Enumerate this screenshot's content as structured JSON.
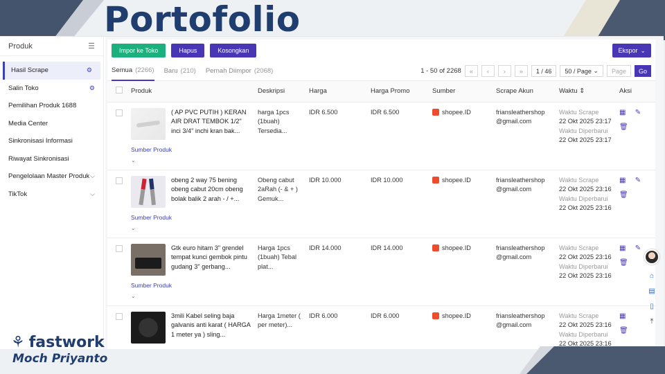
{
  "slide": {
    "title": "Portofolio",
    "brand": "fastwork",
    "author": "Moch Priyanto"
  },
  "colors": {
    "primary": "#4936b5",
    "green": "#1bb07d",
    "brand_navy": "#1f3d6e",
    "shopee": "#ee4d2d"
  },
  "sidebar": {
    "header": "Produk",
    "collapse_icon": "collapse-icon",
    "items": [
      {
        "label": "Hasil Scrape",
        "active": true,
        "icon": "gear-icon"
      },
      {
        "label": "Salin Toko",
        "icon": "gear-icon"
      },
      {
        "label": "Pemilihan Produk 1688"
      },
      {
        "label": "Media Center"
      },
      {
        "label": "Sinkronisasi Informasi"
      },
      {
        "label": "Riwayat Sinkronisasi"
      },
      {
        "label": "Pengelolaan Master Produk",
        "chevron": "chevron-down-icon"
      },
      {
        "label": "TikTok",
        "chevron": "chevron-down-icon"
      }
    ]
  },
  "toolbar": {
    "import": "Impor ke Toko",
    "delete": "Hapus",
    "empty": "Kosongkan",
    "export": "Ekspor"
  },
  "tabs": [
    {
      "label": "Semua",
      "count": "(2266)",
      "active": true
    },
    {
      "label": "Baru",
      "count": "(210)"
    },
    {
      "label": "Pernah Diimpor",
      "count": "(2068)"
    }
  ],
  "pagination": {
    "range": "1 - 50 of 2268",
    "page": "1 / 46",
    "per_page": "50 / Page",
    "page_placeholder": "Page",
    "go": "Go"
  },
  "table": {
    "headers": {
      "produk": "Produk",
      "deskripsi": "Deskripsi",
      "harga": "Harga",
      "promo": "Harga Promo",
      "sumber": "Sumber",
      "akun": "Scrape Akun",
      "waktu": "Waktu",
      "aksi": "Aksi"
    },
    "source_link": "Sumber Produk",
    "time_scrape_label": "Waktu Scrape",
    "time_update_label": "Waktu Diperbarui",
    "rows": [
      {
        "name": "( AP PVC PUTIH ) KERAN AIR DRAT TEMBOK 1/2\" inci 3/4\" inchi kran bak...",
        "desc": "harga 1pcs (1buah) Tersedia...",
        "price": "IDR 6.500",
        "promo": "IDR 6.500",
        "source": "shopee.ID",
        "account": "friansleathershop @gmail.com",
        "scrape_time": "22 Okt 2025 23:17",
        "update_time": "22 Okt 2025 23:17"
      },
      {
        "name": "obeng 2 way 75 bening obeng cabut 20cm obeng bolak balik 2 arah - / +...",
        "desc": "Obeng cabut 2aRah (- & + ) Gemuk...",
        "price": "IDR 10.000",
        "promo": "IDR 10.000",
        "source": "shopee.ID",
        "account": "friansleathershop @gmail.com",
        "scrape_time": "22 Okt 2025 23:16",
        "update_time": "22 Okt 2025 23:16"
      },
      {
        "name": "Gtk euro hitam 3\" grendel tempat kunci gembok pintu gudang 3\" gerbang...",
        "desc": "Harga 1pcs (1buah) Tebal plat...",
        "price": "IDR 14.000",
        "promo": "IDR 14.000",
        "source": "shopee.ID",
        "account": "friansleathershop @gmail.com",
        "scrape_time": "22 Okt 2025 23:16",
        "update_time": "22 Okt 2025 23:16"
      },
      {
        "name": "3mili Kabel seling baja galvanis anti karat ( HARGA 1 meter ya ) sling...",
        "desc": "Harga 1meter ( per meter)...",
        "price": "IDR 6.000",
        "promo": "IDR 6.000",
        "source": "shopee.ID",
        "account": "friansleathershop @gmail.com",
        "scrape_time": "22 Okt 2025 23:16",
        "update_time": "22 Okt 2025 23:16"
      }
    ]
  }
}
